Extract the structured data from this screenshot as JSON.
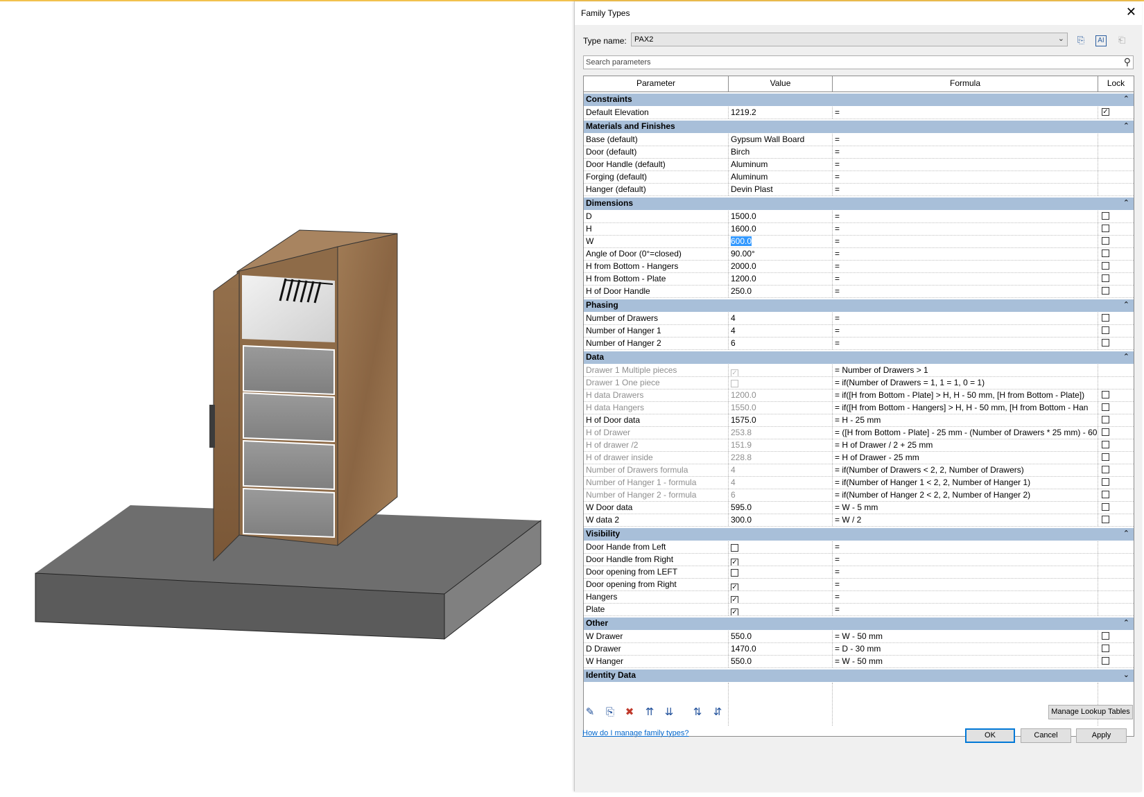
{
  "dialog": {
    "title": "Family Types",
    "close": "✕",
    "type_name_label": "Type name:",
    "type_name_value": "PAX2",
    "search_placeholder": "Search parameters",
    "columns": [
      "Parameter",
      "Value",
      "Formula",
      "Lock"
    ],
    "groups": [
      {
        "name": "Constraints",
        "rows": [
          {
            "param": "Default Elevation",
            "value": "1219.2",
            "formula": "=",
            "lock": "checked"
          }
        ]
      },
      {
        "name": "Materials and Finishes",
        "rows": [
          {
            "param": "Base (default)",
            "value": "Gypsum Wall Board",
            "formula": "=",
            "lock": "none"
          },
          {
            "param": "Door (default)",
            "value": "Birch",
            "formula": "=",
            "lock": "none"
          },
          {
            "param": "Door Handle (default)",
            "value": "Aluminum",
            "formula": "=",
            "lock": "none"
          },
          {
            "param": "Forging (default)",
            "value": "Aluminum",
            "formula": "=",
            "lock": "none"
          },
          {
            "param": "Hanger (default)",
            "value": "Devin Plast",
            "formula": "=",
            "lock": "none"
          }
        ]
      },
      {
        "name": "Dimensions",
        "rows": [
          {
            "param": "D",
            "value": "1500.0",
            "formula": "=",
            "lock": "unchecked"
          },
          {
            "param": "H",
            "value": "1600.0",
            "formula": "=",
            "lock": "unchecked"
          },
          {
            "param": "W",
            "value": "600.0",
            "formula": "=",
            "lock": "unchecked",
            "selected": true
          },
          {
            "param": "Angle of Door (0°=closed)",
            "value": "90.00°",
            "formula": "=",
            "lock": "unchecked"
          },
          {
            "param": "H from Bottom - Hangers",
            "value": "2000.0",
            "formula": "=",
            "lock": "unchecked"
          },
          {
            "param": "H from Bottom - Plate",
            "value": "1200.0",
            "formula": "=",
            "lock": "unchecked"
          },
          {
            "param": "H of Door Handle",
            "value": "250.0",
            "formula": "=",
            "lock": "unchecked"
          }
        ]
      },
      {
        "name": "Phasing",
        "rows": [
          {
            "param": "Number of Drawers",
            "value": "4",
            "formula": "=",
            "lock": "unchecked"
          },
          {
            "param": "Number of Hanger 1",
            "value": "4",
            "formula": "=",
            "lock": "unchecked"
          },
          {
            "param": "Number of Hanger 2",
            "value": "6",
            "formula": "=",
            "lock": "unchecked"
          }
        ]
      },
      {
        "name": "Data",
        "rows": [
          {
            "param": "Drawer 1 Multiple pieces",
            "value": "",
            "value_check": "disabled-checked",
            "formula": "= Number of Drawers > 1",
            "lock": "none",
            "readonly": true
          },
          {
            "param": "Drawer 1 One piece",
            "value": "",
            "value_check": "disabled",
            "formula": "= if(Number of Drawers = 1, 1 = 1, 0 = 1)",
            "lock": "none",
            "readonly": true
          },
          {
            "param": "H data Drawers",
            "value": "1200.0",
            "formula": "= if([H from Bottom - Plate] > H, H - 50 mm, [H from Bottom - Plate])",
            "lock": "unchecked",
            "readonly": true
          },
          {
            "param": "H data Hangers",
            "value": "1550.0",
            "formula": "= if([H from Bottom - Hangers] > H, H - 50 mm, [H from Bottom - Han",
            "lock": "unchecked",
            "readonly": true
          },
          {
            "param": "H of Door data",
            "value": "1575.0",
            "formula": "= H - 25 mm",
            "lock": "unchecked"
          },
          {
            "param": "H of Drawer",
            "value": "253.8",
            "formula": "= ([H from Bottom - Plate] - 25 mm - (Number of Drawers * 25 mm) - 60",
            "lock": "unchecked",
            "readonly": true
          },
          {
            "param": "H of drawer /2",
            "value": "151.9",
            "formula": "= H of Drawer / 2 + 25 mm",
            "lock": "unchecked",
            "readonly": true
          },
          {
            "param": "H of drawer inside",
            "value": "228.8",
            "formula": "= H of Drawer - 25 mm",
            "lock": "unchecked",
            "readonly": true
          },
          {
            "param": "Number of Drawers  formula",
            "value": "4",
            "formula": "= if(Number of Drawers < 2, 2, Number of Drawers)",
            "lock": "unchecked",
            "readonly": true
          },
          {
            "param": "Number of Hanger 1 - formula",
            "value": "4",
            "formula": "= if(Number of Hanger 1 < 2, 2, Number of Hanger 1)",
            "lock": "unchecked",
            "readonly": true
          },
          {
            "param": "Number of Hanger 2 - formula",
            "value": "6",
            "formula": "= if(Number of Hanger 2 < 2, 2, Number of Hanger 2)",
            "lock": "unchecked",
            "readonly": true
          },
          {
            "param": "W Door data",
            "value": "595.0",
            "formula": "= W - 5 mm",
            "lock": "unchecked"
          },
          {
            "param": "W data 2",
            "value": "300.0",
            "formula": "= W / 2",
            "lock": "unchecked"
          }
        ]
      },
      {
        "name": "Visibility",
        "rows": [
          {
            "param": "Door Hande from Left",
            "value": "",
            "value_check": "unchecked",
            "formula": "=",
            "lock": "none"
          },
          {
            "param": "Door Handle from Right",
            "value": "",
            "value_check": "checked",
            "formula": "=",
            "lock": "none"
          },
          {
            "param": "Door opening from LEFT",
            "value": "",
            "value_check": "unchecked",
            "formula": "=",
            "lock": "none"
          },
          {
            "param": "Door opening from Right",
            "value": "",
            "value_check": "checked",
            "formula": "=",
            "lock": "none"
          },
          {
            "param": "Hangers",
            "value": "",
            "value_check": "checked",
            "formula": "=",
            "lock": "none"
          },
          {
            "param": "Plate",
            "value": "",
            "value_check": "checked",
            "formula": "=",
            "lock": "none"
          }
        ]
      },
      {
        "name": "Other",
        "rows": [
          {
            "param": "W Drawer",
            "value": "550.0",
            "formula": "= W - 50 mm",
            "lock": "unchecked"
          },
          {
            "param": "D Drawer",
            "value": "1470.0",
            "formula": "= D - 30 mm",
            "lock": "unchecked"
          },
          {
            "param": "W Hanger",
            "value": "550.0",
            "formula": "= W - 50 mm",
            "lock": "unchecked"
          }
        ]
      },
      {
        "name": "Identity Data",
        "rows": [],
        "collapsed": true
      }
    ],
    "manage_lookup": "Manage Lookup Tables",
    "help_link": "How do I manage family types?",
    "ok": "OK",
    "cancel": "Cancel",
    "apply": "Apply"
  },
  "colors": {
    "group_header": "#a8bfd9",
    "wood": "#9c7650",
    "floor": "#6e6e6e",
    "drawer": "#8f8f8f"
  }
}
